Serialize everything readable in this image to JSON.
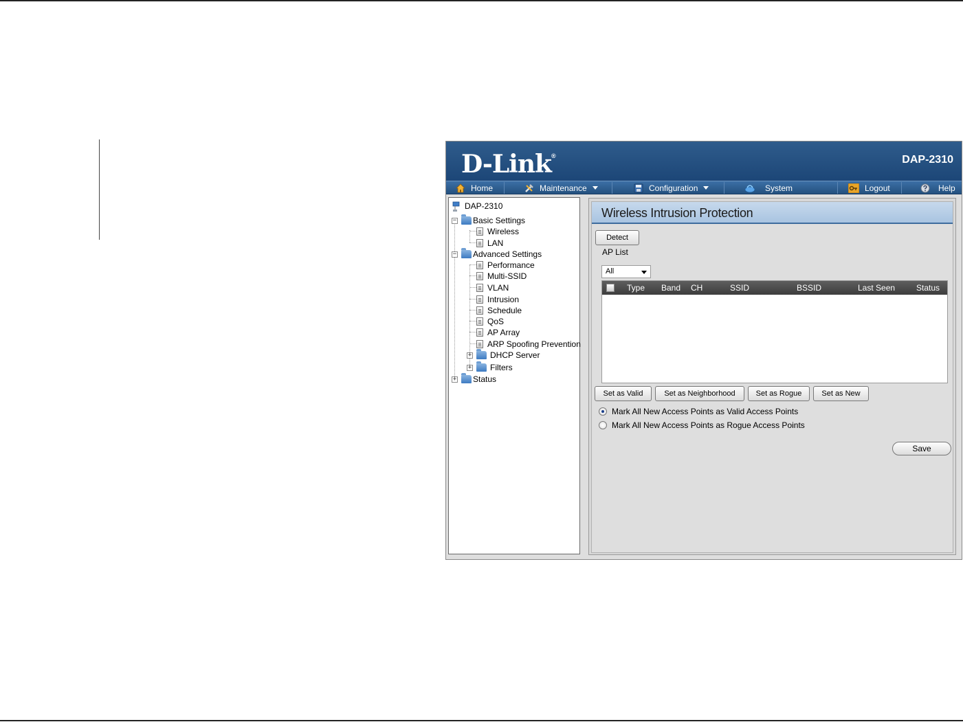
{
  "brand": {
    "logo_text": "D-Link",
    "registered_mark": "®",
    "model": "DAP-2310"
  },
  "nav": {
    "home": "Home",
    "maintenance": "Maintenance",
    "configuration": "Configuration",
    "system": "System",
    "logout": "Logout",
    "help": "Help"
  },
  "tree": {
    "root": "DAP-2310",
    "basic_settings": "Basic Settings",
    "wireless": "Wireless",
    "lan": "LAN",
    "advanced_settings": "Advanced Settings",
    "performance": "Performance",
    "multi_ssid": "Multi-SSID",
    "vlan": "VLAN",
    "intrusion": "Intrusion",
    "schedule": "Schedule",
    "qos": "QoS",
    "ap_array": "AP Array",
    "arp_spoofing": "ARP Spoofing Prevention",
    "dhcp_server": "DHCP Server",
    "filters": "Filters",
    "status": "Status",
    "expand_glyph": "+",
    "collapse_glyph": "−"
  },
  "content": {
    "title": "Wireless Intrusion Protection",
    "detect_button": "Detect",
    "ap_list_label": "AP List",
    "filter_select": "All",
    "columns": {
      "type": "Type",
      "band": "Band",
      "ch": "CH",
      "ssid": "SSID",
      "bssid": "BSSID",
      "last_seen": "Last Seen",
      "status": "Status"
    },
    "set_valid": "Set as Valid",
    "set_neighborhood": "Set as Neighborhood",
    "set_rogue": "Set as Rogue",
    "set_new": "Set as New",
    "radio_valid": "Mark All New Access Points as Valid Access Points",
    "radio_rogue": "Mark All New Access Points as Rogue Access Points",
    "save_button": "Save"
  },
  "colors": {
    "header": "#1c4677",
    "nav": "#2b5a8c",
    "title_bar": "#b8cfe7",
    "list_header": "#4a4a4a"
  }
}
